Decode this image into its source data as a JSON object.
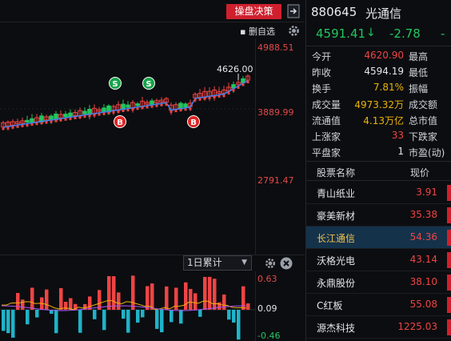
{
  "toolbar": {
    "trade_button": "操盘决策",
    "delete_label": "删自选"
  },
  "chart": {
    "price_axis": [
      "4988.51",
      "3889.99",
      "2791.47"
    ],
    "high_marker": "4626.00",
    "signals": [
      {
        "label": "S",
        "kind": "sell"
      },
      {
        "label": "S",
        "kind": "sell"
      },
      {
        "label": "B",
        "kind": "buy"
      },
      {
        "label": "B",
        "kind": "buy"
      }
    ],
    "period": "1日累计",
    "vol_axis": [
      "0.63",
      "0.09",
      "-0.46"
    ]
  },
  "quote": {
    "code": "880645",
    "name": "光通信",
    "price": "4591.41",
    "arrow": "↓",
    "change": "-2.78",
    "pct": "-",
    "rows": [
      {
        "label": "今开",
        "value": "4620.90",
        "color": "red",
        "label2": "最高"
      },
      {
        "label": "昨收",
        "value": "4594.19",
        "color": "white",
        "label2": "最低"
      },
      {
        "label": "换手",
        "value": "7.81%",
        "color": "yellow",
        "label2": "振幅"
      },
      {
        "label": "成交量",
        "value": "4973.32万",
        "color": "yellow",
        "label2": "成交额"
      },
      {
        "label": "流通值",
        "value": "4.13万亿",
        "color": "yellow",
        "label2": "总市值"
      },
      {
        "label": "上涨家",
        "value": "33",
        "color": "red",
        "label2": "下跌家"
      },
      {
        "label": "平盘家",
        "value": "1",
        "color": "white",
        "label2": "市盈(动)"
      }
    ]
  },
  "stock_list": {
    "header_name": "股票名称",
    "header_price": "现价",
    "rows": [
      {
        "name": "青山纸业",
        "price": "3.91"
      },
      {
        "name": "豪美新材",
        "price": "35.38"
      },
      {
        "name": "长江通信",
        "price": "54.36",
        "selected": true
      },
      {
        "name": "沃格光电",
        "price": "43.14"
      },
      {
        "name": "永鼎股份",
        "price": "38.10"
      },
      {
        "name": "C红板",
        "price": "55.08"
      },
      {
        "name": "源杰科技",
        "price": "1225.03"
      }
    ]
  },
  "colors": {
    "up": "#ef4444",
    "down": "#22c55e",
    "volume_down": "#1fb3c9",
    "accent": "#d0202e"
  }
}
